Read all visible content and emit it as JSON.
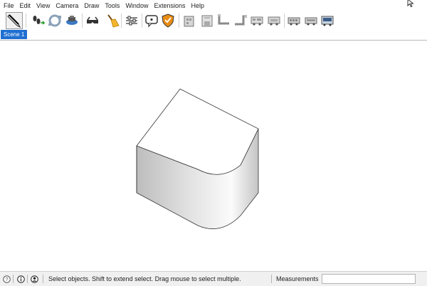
{
  "menu": [
    "File",
    "Edit",
    "View",
    "Camera",
    "Draw",
    "Tools",
    "Window",
    "Extensions",
    "Help"
  ],
  "toolbar": {
    "buttons": [
      {
        "name": "select-tool-icon"
      },
      {
        "name": "walk-tool-icon"
      },
      {
        "name": "orbit-tool-icon"
      },
      {
        "name": "position-camera-icon"
      },
      {
        "name": "glasses-icon"
      },
      {
        "name": "broom-icon"
      },
      {
        "name": "settings-sliders-icon"
      },
      {
        "name": "speech-bubble-icon"
      },
      {
        "name": "shield-icon"
      },
      {
        "name": "building-a-icon"
      },
      {
        "name": "building-b-icon"
      },
      {
        "name": "pipe-a-icon"
      },
      {
        "name": "pipe-b-icon"
      },
      {
        "name": "truck-a-icon"
      },
      {
        "name": "truck-b-icon"
      },
      {
        "name": "bus-a-icon"
      },
      {
        "name": "bus-b-icon"
      },
      {
        "name": "bus-c-icon"
      }
    ]
  },
  "scene_tabs": [
    "Scene 1"
  ],
  "status": {
    "hint": "Select objects. Shift to extend select. Drag mouse to select multiple.",
    "measurements_label": "Measurements",
    "measurements_value": ""
  },
  "colors": {
    "accent": "#1f6fd1",
    "statusbar_bg": "#f0f0f0"
  }
}
